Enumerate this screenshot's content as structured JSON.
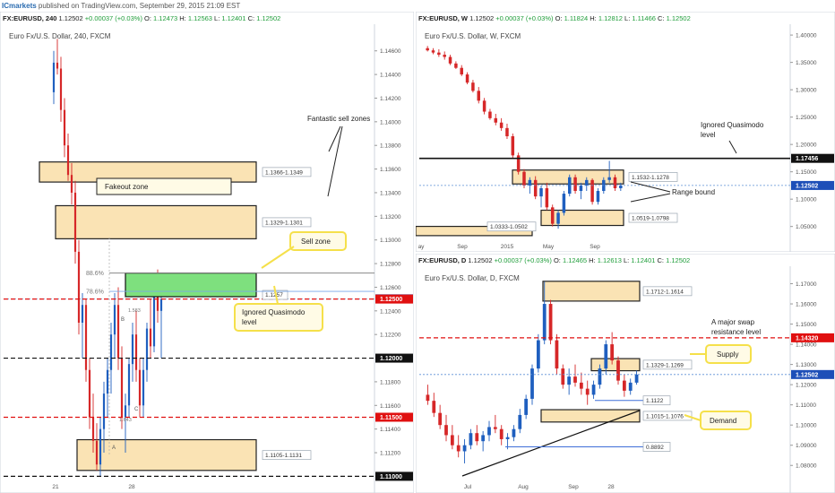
{
  "header": {
    "brand": "ICmarkets",
    "published": "published on TradingView.com, September 29, 2015 21:09 EST"
  },
  "colors": {
    "up": "#1f5fbf",
    "down": "#d62728",
    "zone_fill": "#fae3b4",
    "sell_zone": "#7ee07e",
    "level_red": "#e01010",
    "price_tag": "#1d4fb8",
    "callout_fill": "#fffbe6",
    "callout_border": "#f5e04a"
  },
  "panes": [
    {
      "id": "h4",
      "symbol_line": {
        "sym": "FX:EURUSD, 240",
        "o": "1.12502",
        "chg": "+0.00037 (+0.03%)",
        "ol": "O:",
        "ov": "1.12473",
        "hl": "H:",
        "hv": "1.12563",
        "ll": "L:",
        "lv": "1.12401",
        "cl": "C:",
        "cv": "1.12502"
      },
      "title": "Euro Fx/U.S. Dollar, 240, FXCM",
      "y_axis": {
        "min": 1.1095,
        "max": 1.1478
      },
      "y_ticks": [
        "1.14600",
        "1.14400",
        "1.14200",
        "1.14000",
        "1.13800",
        "1.13600",
        "1.13400",
        "1.13200",
        "1.13000",
        "1.12800",
        "1.12600",
        "1.12400",
        "1.12200",
        "1.11800",
        "1.11600",
        "1.11400",
        "1.11200"
      ],
      "x_ticks": [
        "21",
        "28"
      ],
      "price_tags": [
        {
          "value": 1.12502,
          "text": "1.12502",
          "style": "blue"
        },
        {
          "value": 1.125,
          "text": "1.12500",
          "style": "red"
        },
        {
          "value": 1.12,
          "text": "1.12000",
          "style": "black"
        },
        {
          "value": 1.115,
          "text": "1.11500",
          "style": "red"
        },
        {
          "value": 1.11,
          "text": "1.11000",
          "style": "black"
        }
      ],
      "zones": [
        {
          "kind": "supply",
          "label": "1.1366-1.1349",
          "top": 1.1366,
          "bottom": 1.1349
        },
        {
          "kind": "supply",
          "label": "1.1329-1.1301",
          "top": 1.1329,
          "bottom": 1.1301
        },
        {
          "kind": "demand",
          "label": "1.1105-1.1131",
          "top": 1.1131,
          "bottom": 1.1105
        }
      ],
      "fakeout_label": "Fakeout zone",
      "sell_zone": {
        "top": 1.1272,
        "bottom": 1.1252,
        "tag": "1.1257"
      },
      "fib": [
        {
          "text": "88.6%",
          "value": 1.1272
        },
        {
          "text": "78.6%",
          "value": 1.12565
        }
      ],
      "annotations": {
        "fantastic": "Fantastic sell zones",
        "sell_zone_callout": "Sell zone",
        "quasimodo_callout": [
          "Ignored Quasimodo",
          "level"
        ]
      },
      "harmonic": {
        "a": "A",
        "b": "B",
        "c": "C",
        "r1": "1.643",
        "r2": "1.583"
      },
      "candles": [
        [
          1.1425,
          1.146,
          1.1415,
          1.145
        ],
        [
          1.145,
          1.147,
          1.144,
          1.1445
        ],
        [
          1.1445,
          1.1455,
          1.14,
          1.141
        ],
        [
          1.141,
          1.142,
          1.137,
          1.138
        ],
        [
          1.138,
          1.139,
          1.135,
          1.1355
        ],
        [
          1.1355,
          1.1365,
          1.133,
          1.134
        ],
        [
          1.134,
          1.135,
          1.128,
          1.129
        ],
        [
          1.129,
          1.13,
          1.122,
          1.123
        ],
        [
          1.123,
          1.1255,
          1.12,
          1.1245
        ],
        [
          1.1245,
          1.125,
          1.118,
          1.119
        ],
        [
          1.119,
          1.12,
          1.114,
          1.115
        ],
        [
          1.115,
          1.117,
          1.112,
          1.113
        ],
        [
          1.113,
          1.1145,
          1.1105,
          1.111
        ],
        [
          1.111,
          1.115,
          1.11,
          1.114
        ],
        [
          1.114,
          1.118,
          1.112,
          1.117
        ],
        [
          1.117,
          1.12,
          1.115,
          1.119
        ],
        [
          1.119,
          1.123,
          1.117,
          1.122
        ],
        [
          1.122,
          1.1255,
          1.12,
          1.1245
        ],
        [
          1.1245,
          1.126,
          1.119,
          1.12
        ],
        [
          1.12,
          1.121,
          1.114,
          1.115
        ],
        [
          1.115,
          1.117,
          1.112,
          1.116
        ],
        [
          1.116,
          1.12,
          1.115,
          1.1195
        ],
        [
          1.1195,
          1.123,
          1.118,
          1.122
        ],
        [
          1.122,
          1.124,
          1.118,
          1.119
        ],
        [
          1.119,
          1.12,
          1.115,
          1.116
        ],
        [
          1.116,
          1.12,
          1.115,
          1.119
        ],
        [
          1.119,
          1.123,
          1.118,
          1.1225
        ],
        [
          1.1225,
          1.125,
          1.12,
          1.121
        ],
        [
          1.121,
          1.126,
          1.1205,
          1.1255
        ],
        [
          1.1255,
          1.1275,
          1.123,
          1.124
        ],
        [
          1.124,
          1.1255,
          1.12,
          1.125
        ]
      ]
    },
    {
      "id": "w",
      "symbol_line": {
        "sym": "FX:EURUSD, W",
        "o": "1.12502",
        "chg": "+0.00037 (+0.03%)",
        "ol": "O:",
        "ov": "1.11824",
        "hl": "H:",
        "hv": "1.12812",
        "ll": "L:",
        "lv": "1.11466",
        "cl": "C:",
        "cv": "1.12502"
      },
      "title": "Euro Fx/U.S. Dollar, W, FXCM",
      "y_axis": {
        "min": 1.02,
        "max": 1.41
      },
      "y_ticks": [
        "1.40000",
        "1.35000",
        "1.30000",
        "1.25000",
        "1.20000",
        "1.15000",
        "1.10000",
        "1.05000"
      ],
      "x_ticks": [
        "ay",
        "Sep",
        "2015",
        "May",
        "Sep"
      ],
      "price_tags": [
        {
          "value": 1.17456,
          "text": "1.17456",
          "style": "black"
        },
        {
          "value": 1.12502,
          "text": "1.12502",
          "style": "blue"
        }
      ],
      "zones": [
        {
          "kind": "supply",
          "label": "1.1532-1.1278",
          "top": 1.1532,
          "bottom": 1.1278
        },
        {
          "kind": "demand",
          "label": "1.0519-1.0798",
          "top": 1.0798,
          "bottom": 1.0519
        },
        {
          "kind": "demand",
          "label": "1.0333-1.0502",
          "top": 1.0502,
          "bottom": 1.0333
        }
      ],
      "annotations": {
        "quasimodo": [
          "Ignored Quasimodo",
          "level"
        ],
        "range": "Range bound"
      },
      "candles": [
        [
          1.376,
          1.38,
          1.37,
          1.372
        ],
        [
          1.372,
          1.376,
          1.365,
          1.368
        ],
        [
          1.368,
          1.374,
          1.36,
          1.364
        ],
        [
          1.364,
          1.37,
          1.355,
          1.36
        ],
        [
          1.36,
          1.364,
          1.345,
          1.348
        ],
        [
          1.348,
          1.352,
          1.338,
          1.34
        ],
        [
          1.34,
          1.345,
          1.325,
          1.328
        ],
        [
          1.328,
          1.332,
          1.31,
          1.313
        ],
        [
          1.313,
          1.318,
          1.295,
          1.298
        ],
        [
          1.298,
          1.305,
          1.275,
          1.28
        ],
        [
          1.28,
          1.285,
          1.255,
          1.26
        ],
        [
          1.26,
          1.265,
          1.245,
          1.248
        ],
        [
          1.248,
          1.256,
          1.235,
          1.24
        ],
        [
          1.24,
          1.248,
          1.225,
          1.23
        ],
        [
          1.23,
          1.238,
          1.21,
          1.215
        ],
        [
          1.215,
          1.22,
          1.175,
          1.18
        ],
        [
          1.18,
          1.185,
          1.145,
          1.15
        ],
        [
          1.15,
          1.155,
          1.12,
          1.125
        ],
        [
          1.125,
          1.14,
          1.11,
          1.135
        ],
        [
          1.135,
          1.142,
          1.1,
          1.105
        ],
        [
          1.105,
          1.125,
          1.085,
          1.12
        ],
        [
          1.12,
          1.13,
          1.08,
          1.085
        ],
        [
          1.085,
          1.09,
          1.05,
          1.055
        ],
        [
          1.055,
          1.08,
          1.046,
          1.075
        ],
        [
          1.075,
          1.115,
          1.07,
          1.11
        ],
        [
          1.11,
          1.145,
          1.105,
          1.14
        ],
        [
          1.14,
          1.145,
          1.11,
          1.115
        ],
        [
          1.115,
          1.13,
          1.1,
          1.125
        ],
        [
          1.125,
          1.14,
          1.115,
          1.135
        ],
        [
          1.135,
          1.138,
          1.09,
          1.095
        ],
        [
          1.095,
          1.12,
          1.09,
          1.115
        ],
        [
          1.115,
          1.14,
          1.11,
          1.135
        ],
        [
          1.135,
          1.17,
          1.13,
          1.14
        ],
        [
          1.14,
          1.145,
          1.115,
          1.12
        ],
        [
          1.12,
          1.13,
          1.115,
          1.125
        ]
      ]
    },
    {
      "id": "d",
      "symbol_line": {
        "sym": "FX:EURUSD, D",
        "o": "1.12502",
        "chg": "+0.00037 (+0.03%)",
        "ol": "O:",
        "ov": "1.12465",
        "hl": "H:",
        "hv": "1.12613",
        "ll": "L:",
        "lv": "1.12401",
        "cl": "C:",
        "cv": "1.12502"
      },
      "title": "Euro Fx/U.S. Dollar, D, FXCM",
      "y_axis": {
        "min": 1.073,
        "max": 1.176
      },
      "y_ticks": [
        "1.17000",
        "1.16000",
        "1.15000",
        "1.14000",
        "1.13000",
        "1.12000",
        "1.11000",
        "1.10000",
        "1.09000",
        "1.08000"
      ],
      "x_ticks": [
        "Jul",
        "Aug",
        "Sep",
        "28"
      ],
      "price_tags": [
        {
          "value": 1.1432,
          "text": "1.14320",
          "style": "red"
        },
        {
          "value": 1.12502,
          "text": "1.12502",
          "style": "blue"
        }
      ],
      "zones": [
        {
          "kind": "supply",
          "label": "1.1712-1.1614",
          "top": 1.1712,
          "bottom": 1.1614
        },
        {
          "kind": "supply",
          "label": "1.1329-1.1269",
          "top": 1.1329,
          "bottom": 1.1269
        },
        {
          "kind": "demand",
          "label": "1.1015-1.1076",
          "top": 1.1076,
          "bottom": 1.1015
        }
      ],
      "levels": [
        {
          "text": "1.1122",
          "value": 1.1122
        },
        {
          "text": "0.8892",
          "value": 1.0892
        }
      ],
      "annotations": {
        "swap": [
          "A major swap",
          "resistance level"
        ],
        "supply": "Supply",
        "demand": "Demand"
      },
      "candles": [
        [
          1.115,
          1.12,
          1.11,
          1.112
        ],
        [
          1.112,
          1.116,
          1.104,
          1.106
        ],
        [
          1.106,
          1.11,
          1.098,
          1.1
        ],
        [
          1.1,
          1.105,
          1.092,
          1.095
        ],
        [
          1.095,
          1.1,
          1.088,
          1.09
        ],
        [
          1.09,
          1.095,
          1.084,
          1.087
        ],
        [
          1.087,
          1.093,
          1.081,
          1.09
        ],
        [
          1.09,
          1.098,
          1.088,
          1.096
        ],
        [
          1.096,
          1.1,
          1.09,
          1.092
        ],
        [
          1.092,
          1.097,
          1.087,
          1.095
        ],
        [
          1.095,
          1.102,
          1.092,
          1.099
        ],
        [
          1.099,
          1.105,
          1.096,
          1.098
        ],
        [
          1.098,
          1.1,
          1.09,
          1.093
        ],
        [
          1.093,
          1.096,
          1.088,
          1.094
        ],
        [
          1.094,
          1.1,
          1.092,
          1.098
        ],
        [
          1.098,
          1.108,
          1.096,
          1.105
        ],
        [
          1.105,
          1.115,
          1.103,
          1.113
        ],
        [
          1.113,
          1.13,
          1.11,
          1.128
        ],
        [
          1.128,
          1.145,
          1.126,
          1.142
        ],
        [
          1.142,
          1.171,
          1.14,
          1.16
        ],
        [
          1.16,
          1.162,
          1.14,
          1.142
        ],
        [
          1.142,
          1.145,
          1.125,
          1.128
        ],
        [
          1.128,
          1.13,
          1.118,
          1.12
        ],
        [
          1.12,
          1.128,
          1.115,
          1.124
        ],
        [
          1.124,
          1.13,
          1.119,
          1.121
        ],
        [
          1.121,
          1.126,
          1.115,
          1.118
        ],
        [
          1.118,
          1.122,
          1.11,
          1.115
        ],
        [
          1.115,
          1.122,
          1.113,
          1.12
        ],
        [
          1.12,
          1.13,
          1.118,
          1.128
        ],
        [
          1.128,
          1.142,
          1.125,
          1.14
        ],
        [
          1.14,
          1.146,
          1.13,
          1.132
        ],
        [
          1.132,
          1.134,
          1.12,
          1.122
        ],
        [
          1.122,
          1.125,
          1.114,
          1.117
        ],
        [
          1.117,
          1.123,
          1.115,
          1.121
        ],
        [
          1.121,
          1.127,
          1.12,
          1.125
        ]
      ]
    }
  ],
  "chart_data": [
    {
      "type": "candlestick",
      "title": "Euro Fx/U.S. Dollar, 240, FXCM",
      "ylim": [
        1.1095,
        1.1478
      ],
      "levels": [
        1.125,
        1.12,
        1.115,
        1.11
      ],
      "zones": [
        [
          1.1366,
          1.1349
        ],
        [
          1.1329,
          1.1301
        ],
        [
          1.1105,
          1.1131
        ]
      ]
    },
    {
      "type": "candlestick",
      "title": "Euro Fx/U.S. Dollar, W, FXCM",
      "ylim": [
        1.02,
        1.41
      ],
      "levels": [
        1.17456
      ],
      "zones": [
        [
          1.1532,
          1.1278
        ],
        [
          1.0519,
          1.0798
        ],
        [
          1.0333,
          1.0502
        ]
      ]
    },
    {
      "type": "candlestick",
      "title": "Euro Fx/U.S. Dollar, D, FXCM",
      "ylim": [
        1.073,
        1.176
      ],
      "levels": [
        1.1432,
        1.1122,
        1.0892
      ],
      "zones": [
        [
          1.1712,
          1.1614
        ],
        [
          1.1329,
          1.1269
        ],
        [
          1.1015,
          1.1076
        ]
      ]
    }
  ]
}
